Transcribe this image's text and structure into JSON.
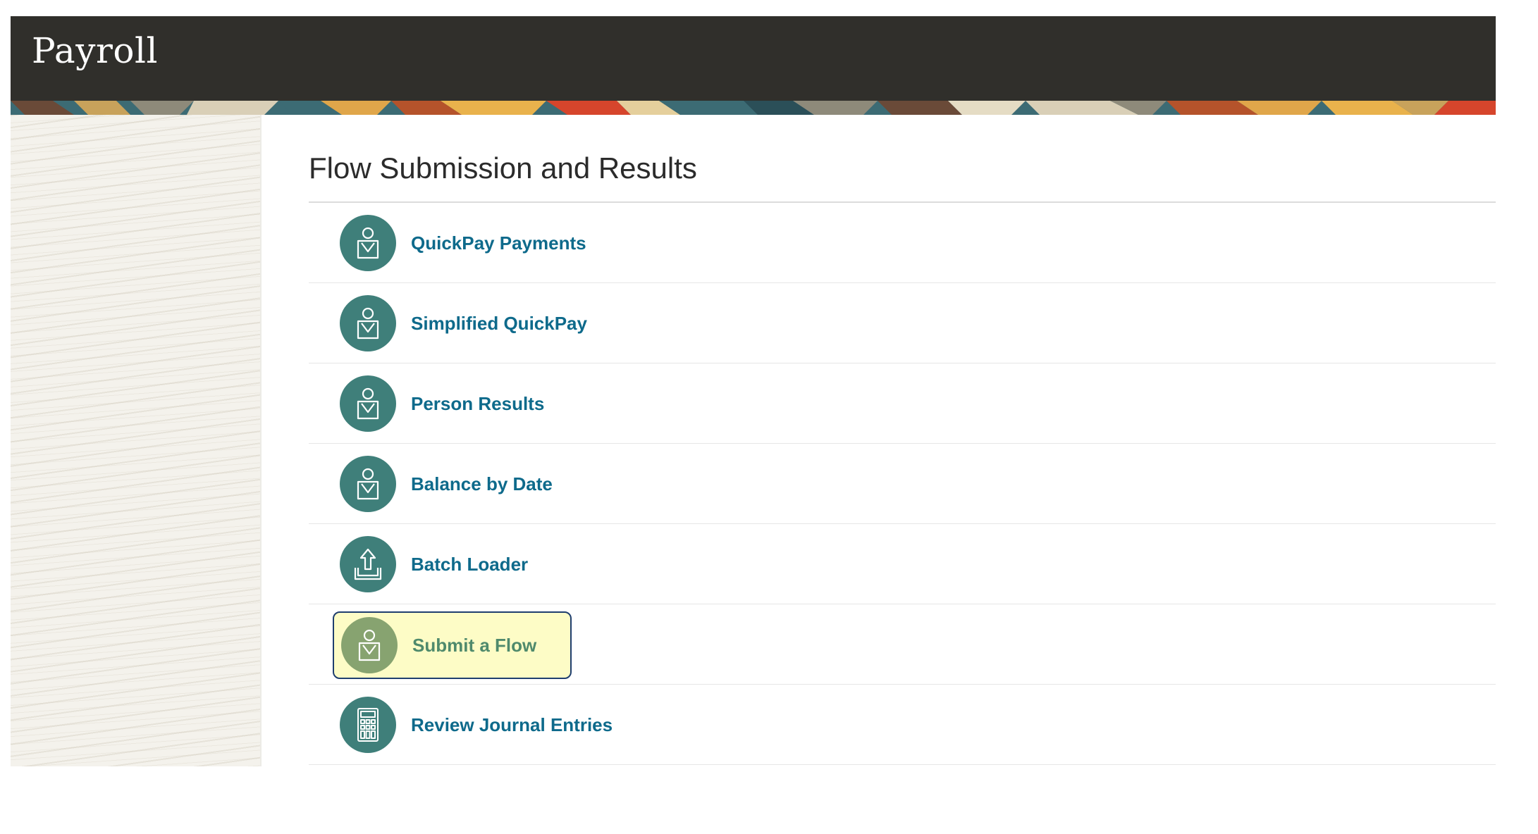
{
  "header": {
    "app_title": "Payroll"
  },
  "main": {
    "section_title": "Flow Submission and Results",
    "tasks": [
      {
        "label": "QuickPay Payments",
        "icon": "person-briefcase-icon"
      },
      {
        "label": "Simplified QuickPay",
        "icon": "person-briefcase-icon"
      },
      {
        "label": "Person Results",
        "icon": "person-briefcase-icon"
      },
      {
        "label": "Balance by Date",
        "icon": "person-briefcase-icon"
      },
      {
        "label": "Batch Loader",
        "icon": "upload-tray-icon"
      },
      {
        "label": "Submit a Flow",
        "icon": "person-briefcase-icon",
        "highlighted": true
      },
      {
        "label": "Review Journal Entries",
        "icon": "calculator-icon"
      }
    ]
  },
  "colors": {
    "header_bg": "#302f2b",
    "icon_bg": "#3f7f7a",
    "link_text": "#0e6a8b",
    "highlight_bg": "#fdfcc6",
    "highlight_border": "#1f3e6e",
    "highlight_icon_bg": "#87a370",
    "highlight_text": "#4f8a6c"
  }
}
